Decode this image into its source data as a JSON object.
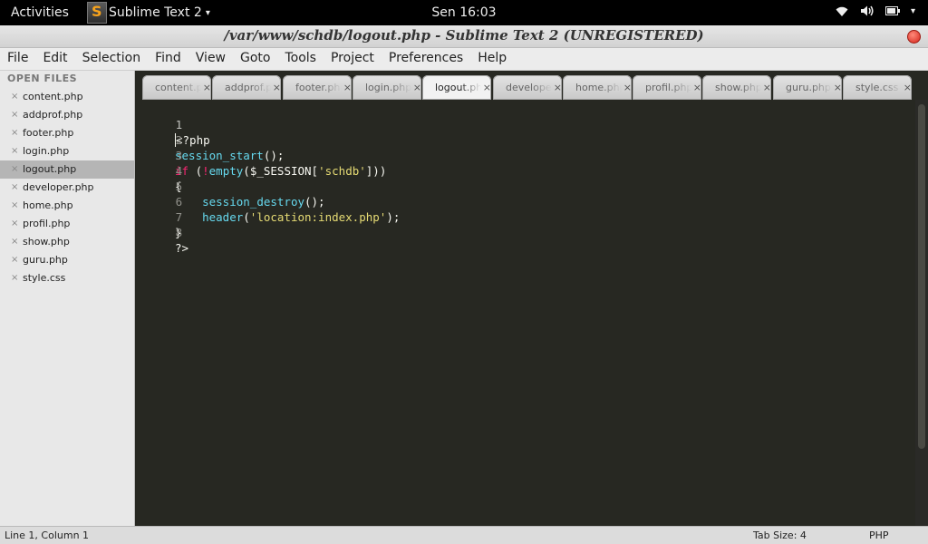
{
  "topbar": {
    "activities": "Activities",
    "app_name": "Sublime Text 2",
    "app_arrow": "▾",
    "clock": "Sen 16:03",
    "tray_icons": [
      "wifi-icon",
      "volume-icon",
      "battery-icon",
      "system-menu-arrow-icon"
    ],
    "tray_arrow": "▾"
  },
  "window": {
    "title": "/var/www/schdb/logout.php - Sublime Text 2 (UNREGISTERED)"
  },
  "menu": [
    "File",
    "Edit",
    "Selection",
    "Find",
    "View",
    "Goto",
    "Tools",
    "Project",
    "Preferences",
    "Help"
  ],
  "sidebar": {
    "header": "OPEN FILES",
    "close_glyph": "×",
    "active_index": 4,
    "files": [
      "content.php",
      "addprof.php",
      "footer.php",
      "login.php",
      "logout.php",
      "developer.php",
      "home.php",
      "profil.php",
      "show.php",
      "guru.php",
      "style.css"
    ]
  },
  "tabs": {
    "active_index": 4,
    "close_glyph": "×",
    "items": [
      "content.php",
      "addprof.php",
      "footer.php",
      "login.php",
      "logout.php",
      "developer.php",
      "home.php",
      "profil.php",
      "show.php",
      "guru.php",
      "style.css"
    ]
  },
  "editor": {
    "line_numbers": [
      "1",
      "2",
      "3",
      "4",
      "5",
      "6",
      "7",
      "8"
    ],
    "colors": {
      "background": "#272822",
      "keyword": "#f92672",
      "function": "#66d9ef",
      "string": "#e6db74",
      "text": "#f8f8f2"
    },
    "l1": {
      "t1": "<?php"
    },
    "l2": {
      "fn": "session_start",
      "t1": "();"
    },
    "l3": {
      "kw1": "if",
      "t1": " (",
      "kw2": "!",
      "fn": "empty",
      "t2": "($_SESSION[",
      "str": "'schdb'",
      "t3": "]))"
    },
    "l4": {
      "t1": "{"
    },
    "l5": {
      "indent": "    ",
      "fn": "session_destroy",
      "t1": "();"
    },
    "l6": {
      "indent": "    ",
      "fn": "header",
      "t1": "(",
      "str": "'location:index.php'",
      "t2": ");"
    },
    "l7": {
      "t1": "}"
    },
    "l8": {
      "t1": "?>"
    }
  },
  "status": {
    "position": "Line 1, Column 1",
    "tab_size": "Tab Size: 4",
    "syntax": "PHP"
  }
}
